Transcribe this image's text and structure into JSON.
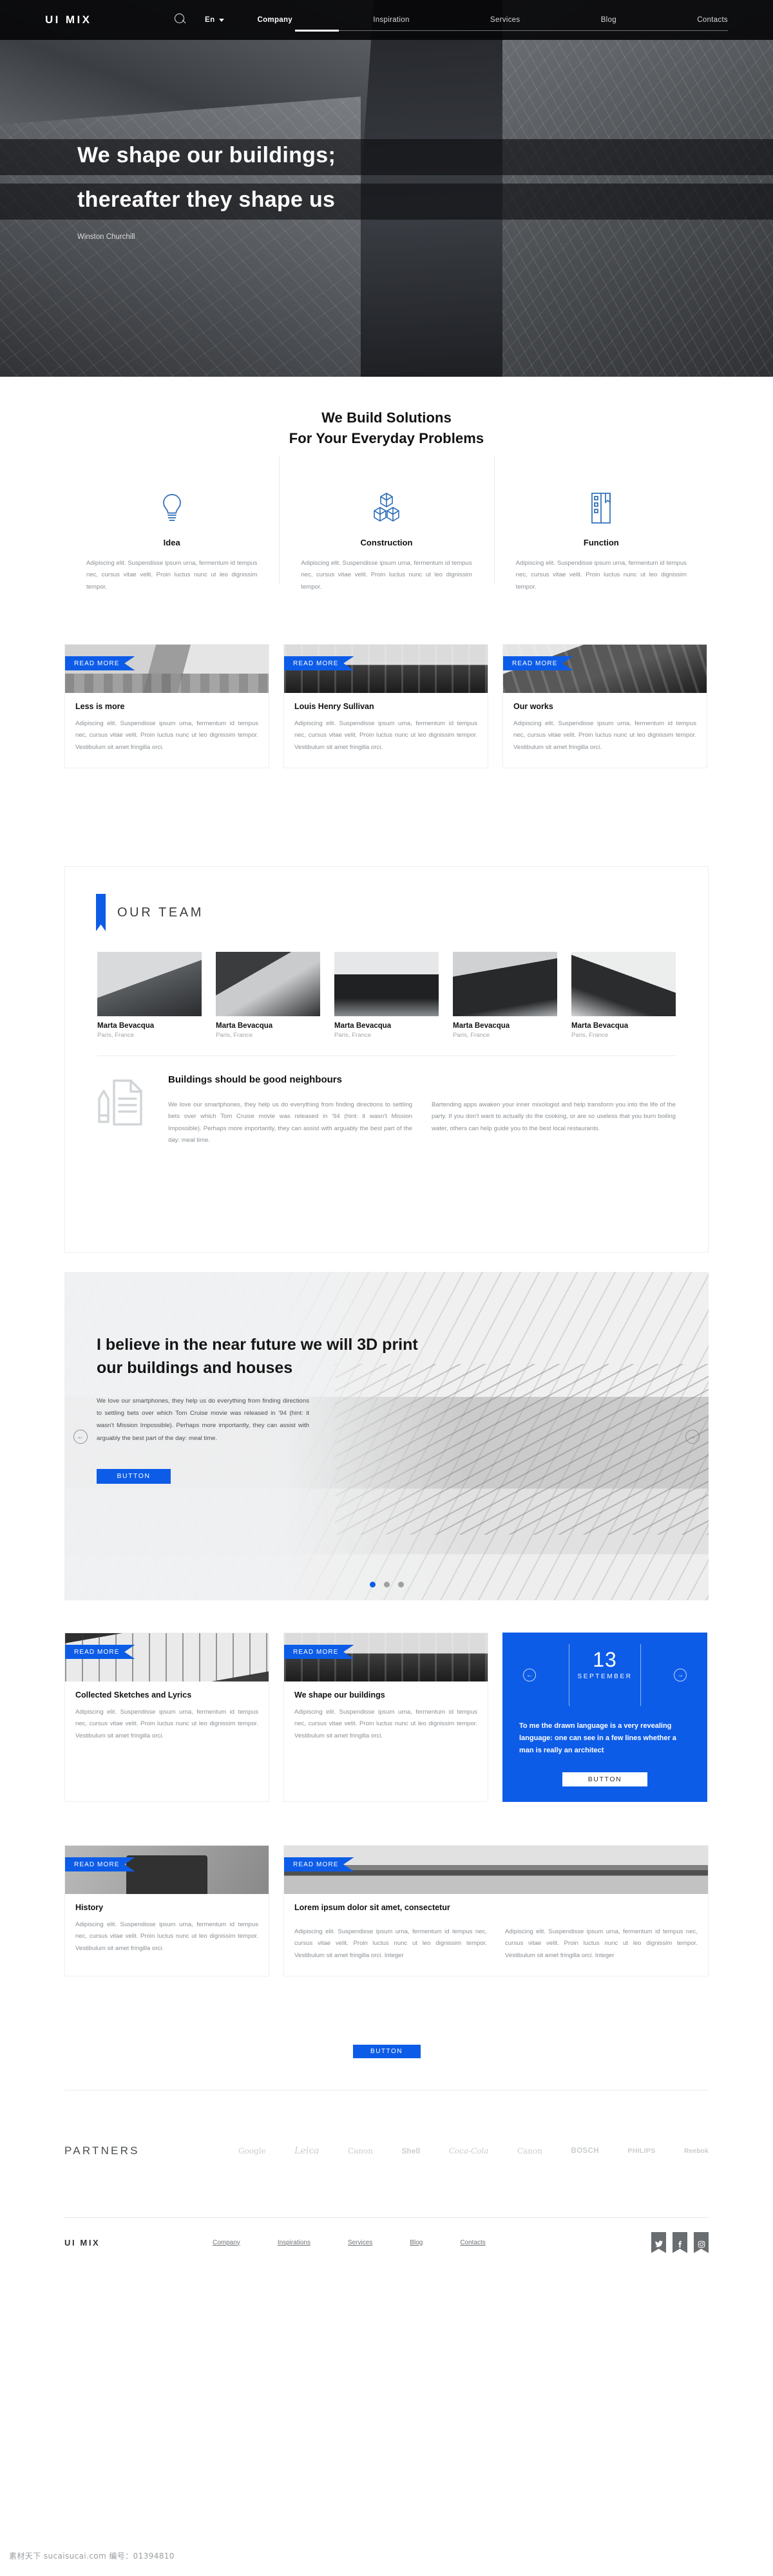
{
  "header": {
    "logo": "UI MIX",
    "search_icon": "search-icon",
    "language": "En",
    "nav": [
      {
        "label": "Company",
        "active": true
      },
      {
        "label": "Inspiration",
        "active": false
      },
      {
        "label": "Services",
        "active": false
      },
      {
        "label": "Blog",
        "active": false
      },
      {
        "label": "Contacts",
        "active": false
      }
    ]
  },
  "hero": {
    "line1": "We shape our buildings;",
    "line2": "thereafter they shape us",
    "author": "Winston Churchill"
  },
  "solutions": {
    "title_line1": "We Build Solutions",
    "title_line2": "For Your Everyday Problems",
    "items": [
      {
        "icon": "lightbulb-icon",
        "name": "Idea",
        "text": "Adipiscing elit. Suspendisse ipsum urna, fermentum id tempus nec, cursus vitae velit. Proin luctus nunc ut leo dignissim tempor."
      },
      {
        "icon": "cubes-icon",
        "name": "Construction",
        "text": "Adipiscing elit. Suspendisse ipsum urna, fermentum id tempus nec, cursus vitae velit. Proin luctus nunc ut leo dignissim tempor."
      },
      {
        "icon": "building-icon",
        "name": "Function",
        "text": "Adipiscing elit. Suspendisse ipsum urna, fermentum id tempus nec, cursus vitae velit. Proin luctus nunc ut leo dignissim tempor."
      }
    ]
  },
  "cards_row1": {
    "ribbon_label": "READ MORE",
    "items": [
      {
        "title": "Less is more",
        "text": "Adipiscing elit. Suspendisse ipsum urna, fermentum id tempus nec, cursus vitae velit. Proin luctus nunc ut leo dignissim tempor. Vestibulum sit amet fringilla orci."
      },
      {
        "title": "Louis Henry Sullivan",
        "text": "Adipiscing elit. Suspendisse ipsum urna, fermentum id tempus nec, cursus vitae velit. Proin luctus nunc ut leo dignissim tempor. Vestibulum sit amet fringilla orci."
      },
      {
        "title": "Our works",
        "text": "Adipiscing elit. Suspendisse ipsum urna, fermentum id tempus nec, cursus vitae velit. Proin luctus nunc ut leo dignissim tempor. Vestibulum sit amet fringilla orci."
      }
    ]
  },
  "team": {
    "title": "OUR TEAM",
    "members": [
      {
        "name": "Marta Bevacqua",
        "location": "Paris, France"
      },
      {
        "name": "Marta Bevacqua",
        "location": "Paris, France"
      },
      {
        "name": "Marta Bevacqua",
        "location": "Paris, France"
      },
      {
        "name": "Marta Bevacqua",
        "location": "Paris, France"
      },
      {
        "name": "Marta Bevacqua",
        "location": "Paris, France"
      }
    ],
    "neighbours": {
      "icon": "document-pencil-icon",
      "title": "Buildings should be good neighbours",
      "col1": "We love our smartphones, they help us do everything from finding directions to settling bets over which Tom Cruise movie was released in '94 (hint: it wasn't Mission Impossible). Perhaps more importantly, they can assist with arguably the best part of the day: meal time.",
      "col2": "Bartending apps awaken your inner mixologist and help transform you into the life of the party. If you don't want to actually do the cooking, or are so useless that you burn boiling water, others can help guide you to the best local restaurants."
    }
  },
  "slider": {
    "title": "I believe in the near future we will 3D print our buildings and houses",
    "text": "We love our smartphones, they help us do everything from finding directions to settling bets over which Tom Cruise movie was released in '94 (hint: it wasn't Mission Impossible). Perhaps more importantly, they can assist with arguably the best part of the day: meal time.",
    "button": "BUTTON",
    "prev_icon": "arrow-left-icon",
    "next_icon": "arrow-right-icon",
    "dots": 3,
    "active_dot": 0
  },
  "cards_row2": {
    "ribbon_label": "READ MORE",
    "items": [
      {
        "title": "Collected Sketches and Lyrics",
        "text": "Adipiscing elit. Suspendisse ipsum urna, fermentum id tempus nec, cursus vitae velit. Proin luctus nunc ut leo dignissim tempor. Vestibulum sit amet fringilla orci."
      },
      {
        "title": "We shape our buildings",
        "text": "Adipiscing elit. Suspendisse ipsum urna, fermentum id tempus nec, cursus vitae velit. Proin luctus nunc ut leo dignissim tempor. Vestibulum sit amet fringilla orci."
      }
    ],
    "quote_card": {
      "day": "13",
      "month": "SEPTEMBER",
      "quote": "To me the drawn language is a very revealing language: one can see in a few lines whether a man is really an architect",
      "button": "BUTTON",
      "prev_icon": "arrow-left-icon",
      "next_icon": "arrow-right-icon"
    }
  },
  "cards_row3": {
    "ribbon_label": "READ MORE",
    "history": {
      "title": "History",
      "text": "Adipiscing elit. Suspendisse ipsum urna, fermentum id tempus nec, cursus vitae velit. Proin luctus nunc ut leo dignissim tempor. Vestibulum sit amet fringilla orci."
    },
    "wide": {
      "title": "Lorem ipsum dolor sit amet, consectetur",
      "col1": "Adipiscing elit. Suspendisse ipsum urna, fermentum id tempus nec, cursus vitae velit. Proin luctus nunc ut leo dignissim tempor. Vestibulum sit amet fringilla orci. Integer",
      "col2": "Adipiscing elit. Suspendisse ipsum urna, fermentum id tempus nec, cursus vitae velit. Proin luctus nunc ut leo dignissim tempor. Vestibulum sit amet fringilla orci. Integer"
    },
    "button": "BUTTON"
  },
  "partners": {
    "label": "PARTNERS",
    "logos": [
      "Google",
      "Leica",
      "Canon",
      "Shell",
      "Coca-Cola",
      "Canon",
      "BOSCH",
      "PHILIPS",
      "Reebok"
    ]
  },
  "footer": {
    "logo": "UI MIX",
    "nav": [
      "Company",
      "Inspirations",
      "Services",
      "Blog",
      "Contacts"
    ],
    "socials": [
      {
        "icon": "twitter-icon",
        "glyph": "✈"
      },
      {
        "icon": "facebook-icon",
        "glyph": "f"
      },
      {
        "icon": "instagram-icon",
        "glyph": "▣"
      }
    ]
  },
  "watermark": "素材天下 sucaisucai.com  编号：01394810",
  "colors": {
    "accent": "#0d5ce8",
    "dark": "#0a0a0c",
    "muted": "#8a8f94"
  }
}
